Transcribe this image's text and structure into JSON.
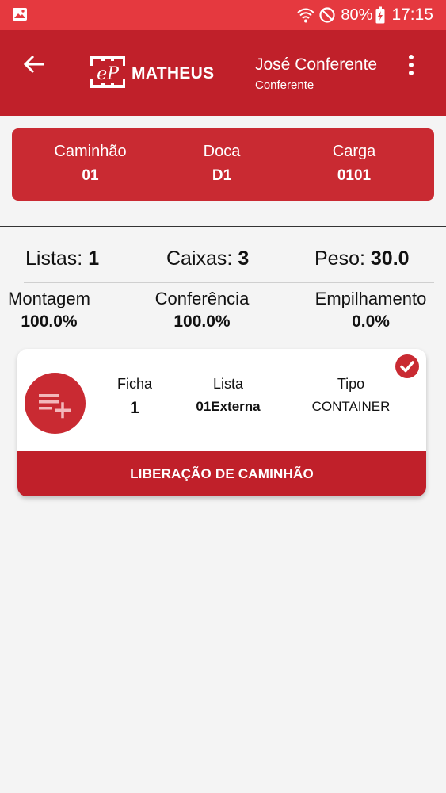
{
  "status_bar": {
    "battery": "80%",
    "time": "17:15"
  },
  "app_bar": {
    "title": "MATHEUS",
    "logo_text": "eP",
    "user_name": "José Conferente",
    "user_role": "Conferente"
  },
  "info_card": {
    "caminhao_label": "Caminhão",
    "caminhao_value": "01",
    "doca_label": "Doca",
    "doca_value": "D1",
    "carga_label": "Carga",
    "carga_value": "0101"
  },
  "stats": {
    "listas_label": "Listas:",
    "listas_value": "1",
    "caixas_label": "Caixas:",
    "caixas_value": "3",
    "peso_label": "Peso:",
    "peso_value": "30.0",
    "montagem_label": "Montagem",
    "montagem_value": "100.0%",
    "conferencia_label": "Conferência",
    "conferencia_value": "100.0%",
    "empilhamento_label": "Empilhamento",
    "empilhamento_value": "0.0%"
  },
  "list_card": {
    "ficha_label": "Ficha",
    "ficha_value": "1",
    "lista_label": "Lista",
    "lista_value": "01Externa",
    "tipo_label": "Tipo",
    "tipo_value": "CONTAINER",
    "action_label": "LIBERAÇÃO DE CAMINHÃO"
  },
  "colors": {
    "status_bar": "#e5393f",
    "app_bar": "#c0202a",
    "accent": "#c92a32"
  }
}
